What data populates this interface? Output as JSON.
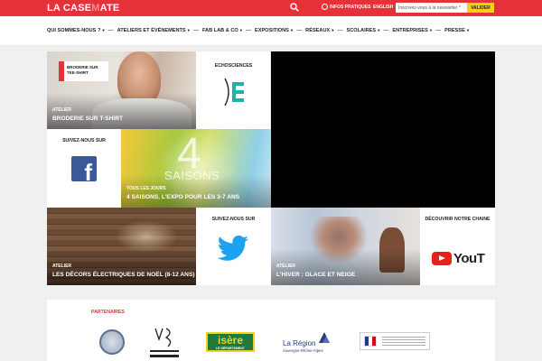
{
  "header": {
    "logo_left": "LA CASE",
    "logo_mid": "M",
    "logo_right": "ATE",
    "infos_label": "INFOS PRATIQUES",
    "lang_label": "ENGLISH",
    "newsletter_placeholder": "Inscrivez-vous à la newsletter *",
    "validate_label": "VALIDER"
  },
  "nav": {
    "items": [
      {
        "label": "QUI SOMMES-NOUS ?"
      },
      {
        "label": "ATELIERS ET ÉVÉNEMENTS"
      },
      {
        "label": "FAB LAB & CO"
      },
      {
        "label": "EXPOSITIONS"
      },
      {
        "label": "RÉSEAUX"
      },
      {
        "label": "SCOLAIRES"
      },
      {
        "label": "ENTREPRISES"
      },
      {
        "label": "PRESSE"
      }
    ]
  },
  "tiles": {
    "embroidery": {
      "card_line1": "BRODERIE SUR",
      "card_line2": "TEE-SHIRT",
      "kind": "ATELIER",
      "name": "BRODERIE SUR T-SHIRT"
    },
    "echo": {
      "title": "ECHOSCIENCES"
    },
    "follow_fb": {
      "title": "SUIVEZ-NOUS SUR"
    },
    "saisons": {
      "big": "4",
      "word": "SAISONS",
      "kind": "TOUS LES JOURS",
      "name": "4 SAISONS, L'EXPO POUR LES 3-7 ANS"
    },
    "decor": {
      "kind": "ATELIER",
      "name": "LES DÉCORS ÉLECTRIQUES DE NOËL (8-12 ANS)"
    },
    "follow_tw": {
      "title": "SUIVEZ-NOUS SUR"
    },
    "hiver": {
      "kind": "ATELIER",
      "name": "L'HIVER : GLACE ET NEIGE"
    },
    "youtube": {
      "title": "DÉCOUVRIR NOTRE CHAINE",
      "logo_text": "YouT"
    }
  },
  "partners": {
    "heading": "PARTENAIRES",
    "isere_word": "isère",
    "isere_sub": "LE DÉPARTEMENT",
    "region_word": "La Région",
    "region_sub": "Auvergne-Rhône-Alpes"
  },
  "colors": {
    "brand_red": "#e53238",
    "validate_yellow": "#f8cf1a",
    "facebook_blue": "#3b5998",
    "twitter_blue": "#1da1f2",
    "youtube_red": "#e62117",
    "echosciences_teal": "#1ab3a6"
  },
  "icons": {
    "search": "search-icon",
    "infos": "clock-icon",
    "facebook": "facebook-icon",
    "twitter": "twitter-icon",
    "youtube": "youtube-icon",
    "echosciences": "echosciences-icon"
  }
}
